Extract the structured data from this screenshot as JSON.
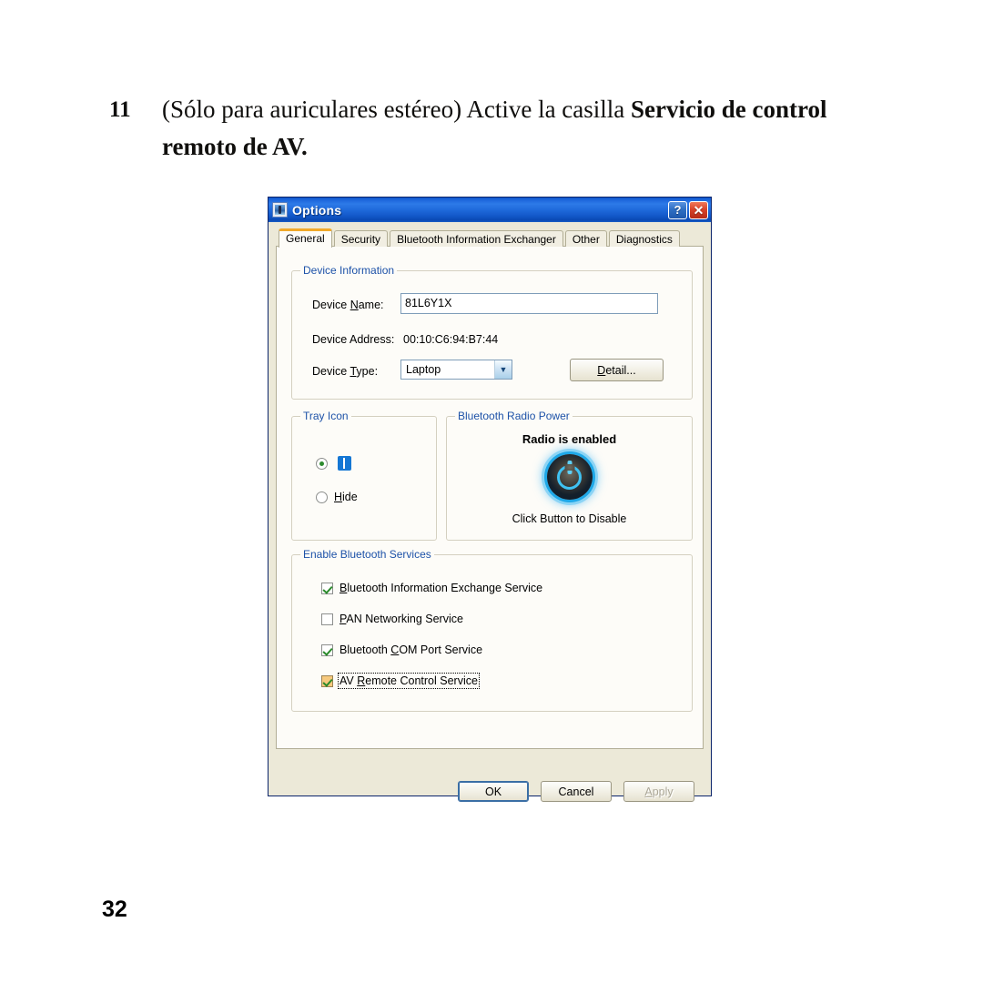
{
  "page": {
    "step_number": "11",
    "instruction_prefix": "(Sólo para auriculares estéreo) Active la casilla ",
    "instruction_bold": "Servicio de control remoto de AV.",
    "page_number": "32"
  },
  "dialog": {
    "title": "Options",
    "icon": "bluetooth-options-icon",
    "help_button": "?",
    "close_button": "✕",
    "tabs": [
      {
        "label": "General",
        "selected": true
      },
      {
        "label": "Security",
        "selected": false
      },
      {
        "label": "Bluetooth Information Exchanger",
        "selected": false
      },
      {
        "label": "Other",
        "selected": false
      },
      {
        "label": "Diagnostics",
        "selected": false
      }
    ],
    "device_information": {
      "legend": "Device Information",
      "device_name_label_pre": "Device ",
      "device_name_label_accel": "N",
      "device_name_label_post": "ame:",
      "device_name_value": "81L6Y1X",
      "device_address_label": "Device Address:",
      "device_address_value": "00:10:C6:94:B7:44",
      "device_type_label_pre": "Device ",
      "device_type_label_accel": "T",
      "device_type_label_post": "ype:",
      "device_type_value": "Laptop",
      "detail_button_accel": "D",
      "detail_button_post": "etail..."
    },
    "tray_icon": {
      "legend": "Tray Icon",
      "show_option": {
        "icon": "bluetooth-icon",
        "selected": true
      },
      "hide_option": {
        "label_accel": "H",
        "label_post": "ide",
        "selected": false
      }
    },
    "radio_power": {
      "legend": "Bluetooth Radio Power",
      "status": "Radio is enabled",
      "hint": "Click Button to Disable",
      "button_icon": "power-button-icon"
    },
    "services": {
      "legend": "Enable Bluetooth Services",
      "items": [
        {
          "pre": "",
          "accel": "B",
          "post": "luetooth Information Exchange Service",
          "checked": true,
          "focused": false
        },
        {
          "pre": "",
          "accel": "P",
          "post": "AN Networking Service",
          "checked": false,
          "focused": false
        },
        {
          "pre": "Bluetooth ",
          "accel": "C",
          "post": "OM Port Service",
          "checked": true,
          "focused": false
        },
        {
          "pre": "AV ",
          "accel": "R",
          "post": "emote Control Service",
          "checked": true,
          "focused": true
        }
      ]
    },
    "footer": {
      "ok_label": "OK",
      "cancel_label": "Cancel",
      "apply_accel": "A",
      "apply_post": "pply",
      "apply_disabled": true
    },
    "colors": {
      "titlebar_blue": "#1f6adb",
      "dialog_face": "#ece9d8",
      "panel_face": "#fdfcf8",
      "legend_blue": "#1d52a8",
      "tab_accent_orange": "#f0a92a",
      "check_green": "#2a8a2a",
      "power_cyan": "#3fc2f2"
    }
  }
}
